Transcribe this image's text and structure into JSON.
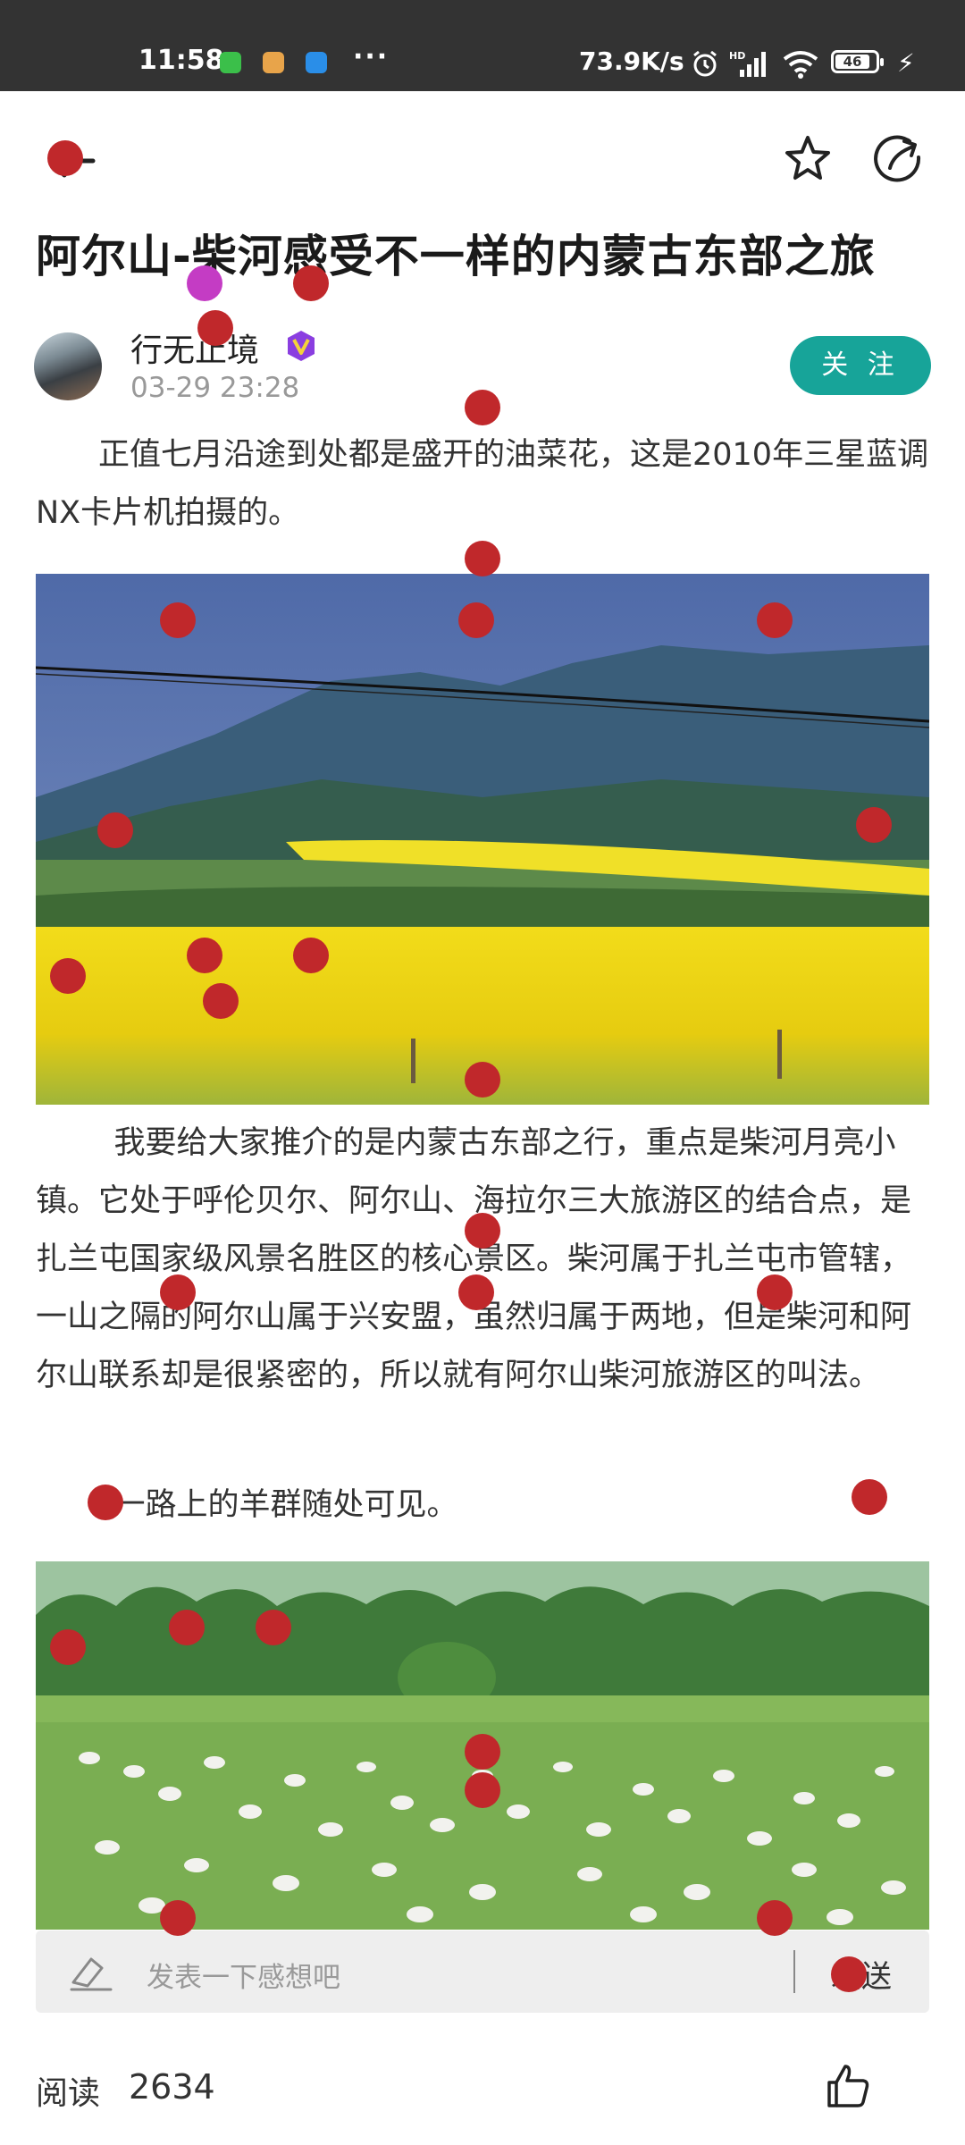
{
  "status_bar": {
    "time": "11:58",
    "more_dots": "···",
    "network_speed": "73.9K/s",
    "battery_level": "46"
  },
  "nav": {
    "back_icon": "back-arrow-icon",
    "favorite_icon": "star-icon",
    "share_icon": "share-icon"
  },
  "article": {
    "title": "阿尔山-柴河感受不一样的内蒙古东部之旅",
    "author": "行无止境",
    "badge_icon": "vip-v-icon",
    "timestamp": "03-29 23:28",
    "follow_label": "关 注",
    "paragraph1": "正值七月沿途到处都是盛开的油菜花，这是2010年三星蓝调NX卡片机拍摄的。",
    "paragraph2": "我要给大家推介的是内蒙古东部之行，重点是柴河月亮小镇。它处于呼伦贝尔、阿尔山、海拉尔三大旅游区的结合点，是扎兰屯国家级风景名胜区的核心景区。柴河属于扎兰屯市管辖，一山之隔的阿尔山属于兴安盟，虽然归属于两地，但是柴河和阿尔山联系却是很紧密的，所以就有阿尔山柴河旅游区的叫法。",
    "paragraph3": "一路上的羊群随处可见。"
  },
  "comment": {
    "pen_icon": "edit-icon",
    "placeholder": "发表一下感想吧",
    "send_label": "发送"
  },
  "footer": {
    "read_label": "阅读",
    "read_count": "2634",
    "like_icon": "thumbs-up-icon"
  },
  "colors": {
    "accent": "#17a499",
    "marker": "#c0282b",
    "status_bar": "#333333"
  }
}
